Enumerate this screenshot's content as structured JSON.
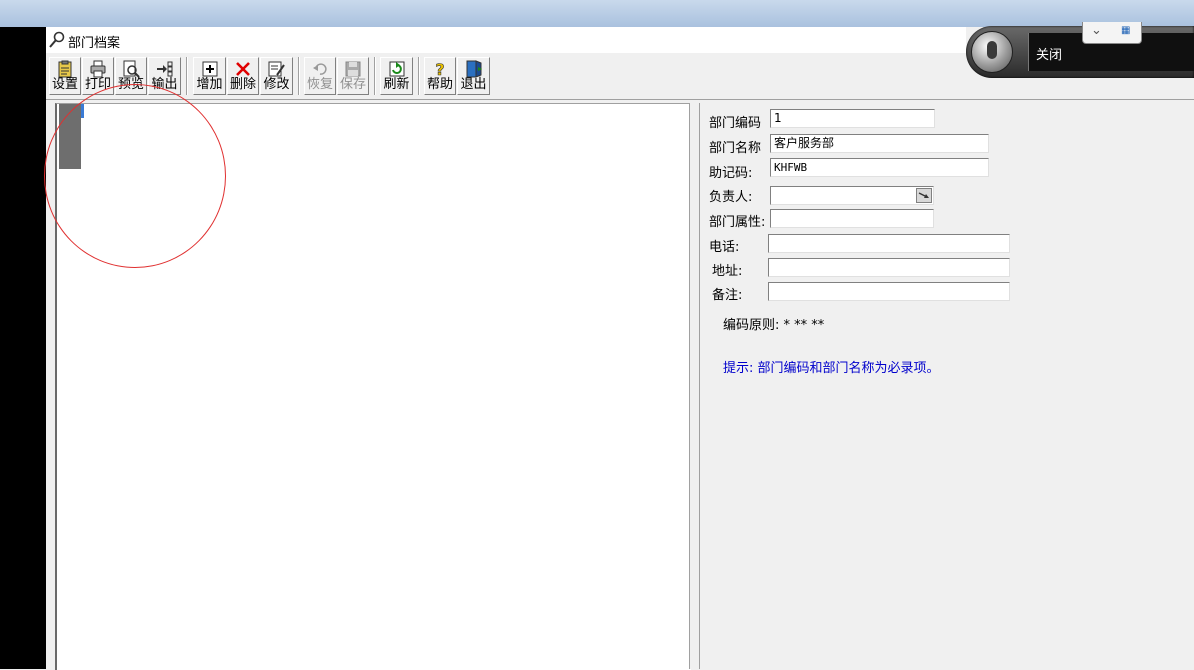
{
  "window": {
    "title": "部门档案"
  },
  "toolbar": {
    "buttons": [
      {
        "label": "设置",
        "icon": "clipboard-icon"
      },
      {
        "label": "打印",
        "icon": "printer-icon"
      },
      {
        "label": "预览",
        "icon": "preview-icon"
      },
      {
        "label": "输出",
        "icon": "export-icon"
      },
      {
        "label": "增加",
        "icon": "add-icon"
      },
      {
        "label": "删除",
        "icon": "delete-icon"
      },
      {
        "label": "修改",
        "icon": "edit-icon"
      },
      {
        "label": "恢复",
        "icon": "undo-icon",
        "disabled": true
      },
      {
        "label": "保存",
        "icon": "save-icon",
        "disabled": true
      },
      {
        "label": "刷新",
        "icon": "refresh-icon"
      },
      {
        "label": "帮助",
        "icon": "help-icon"
      },
      {
        "label": "退出",
        "icon": "exit-icon"
      }
    ]
  },
  "form": {
    "dept_code": {
      "label": "部门编码",
      "value": "1"
    },
    "dept_name": {
      "label": "部门名称",
      "value": "客户服务部"
    },
    "mnemonic": {
      "label": "助记码:",
      "value": "KHFWB"
    },
    "manager": {
      "label": "负责人:",
      "value": ""
    },
    "attribute": {
      "label": "部门属性:",
      "value": ""
    },
    "phone": {
      "label": "电话:",
      "value": ""
    },
    "address": {
      "label": "地址:",
      "value": ""
    },
    "remark": {
      "label": "备注:",
      "value": ""
    },
    "code_rule": "编码原则: * ** **",
    "hint": "提示: 部门编码和部门名称为必录项。"
  },
  "voice_bar": {
    "close_label": "关闭"
  },
  "colors": {
    "hint": "#0000cc",
    "annotation_circle": "#e03030",
    "title_gradient": "#a9c1de"
  }
}
